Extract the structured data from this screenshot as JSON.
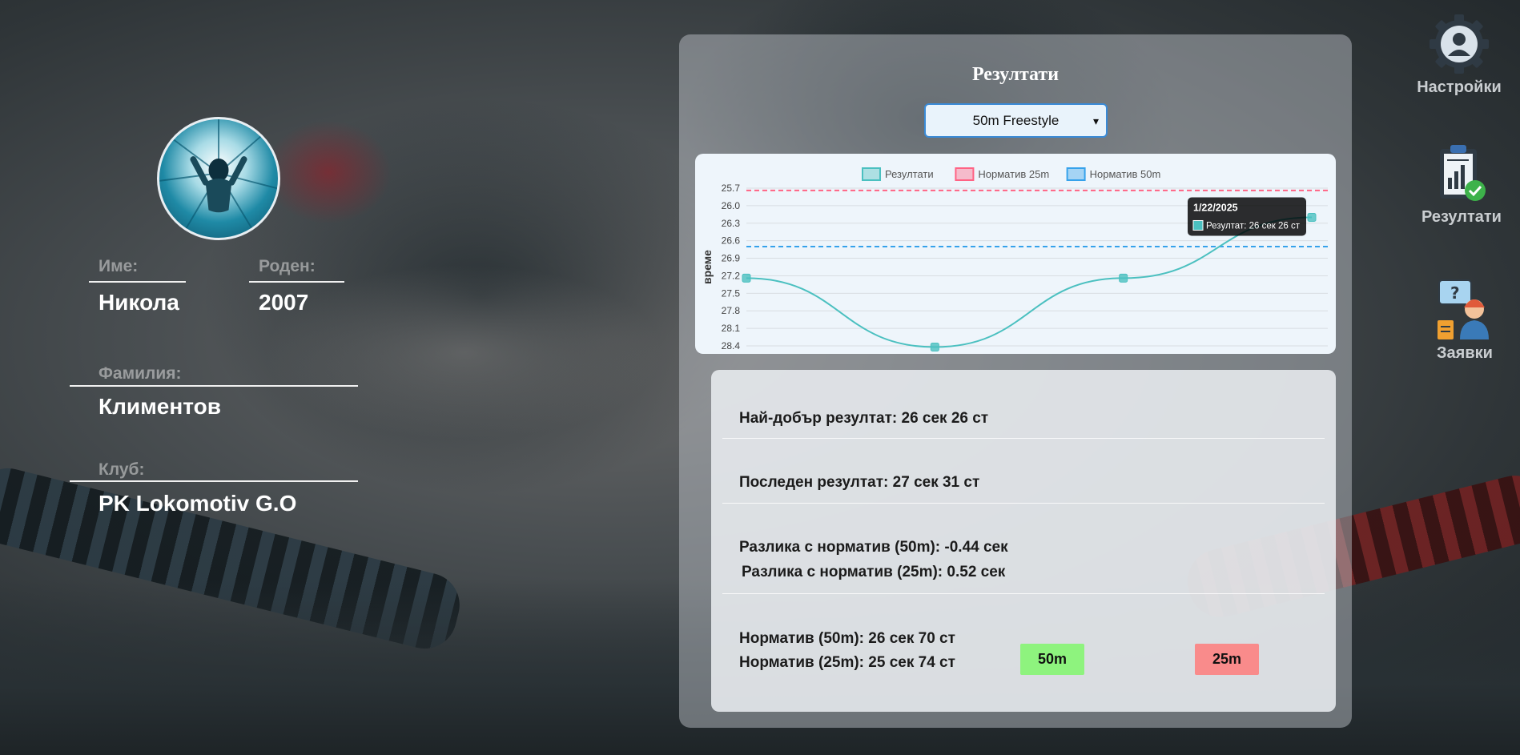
{
  "profile": {
    "labels": {
      "first_name": "Име:",
      "born": "Роден:",
      "last_name": "Фамилия:",
      "club": "Клуб:"
    },
    "first_name": "Никола",
    "born": "2007",
    "last_name": "Климентов",
    "club": "PK Lokomotiv G.O"
  },
  "results_panel": {
    "title": "Резултати",
    "event_select": {
      "selected": "50m Freestyle"
    }
  },
  "chart_data": {
    "type": "line",
    "legend": [
      "Резултати",
      "Норматив 25m",
      "Норматив 50m"
    ],
    "ylabel": "време",
    "y_ticks": [
      "25.7",
      "26.0",
      "26.3",
      "26.6",
      "26.9",
      "27.2",
      "27.5",
      "27.8",
      "28.1",
      "28.4"
    ],
    "ylim": [
      28.4,
      25.7
    ],
    "y_reversed": true,
    "series": [
      {
        "name": "Резултати",
        "color": "#4bc0c0",
        "values": [
          27.24,
          28.42,
          27.24,
          26.2
        ]
      }
    ],
    "reference_lines": [
      {
        "name": "Норматив 25m",
        "color": "#ff6384",
        "value": 25.74
      },
      {
        "name": "Норматив 50m",
        "color": "#36a2eb",
        "value": 26.7
      }
    ],
    "tooltip": {
      "title": "1/22/2025",
      "text": "Резултат: 26 сек 26 ст"
    }
  },
  "stats": {
    "best": "Най-добър резултат: 26 сек 26 ст",
    "last": "Последен резултат: 27 сек 31 ст",
    "diff_50": "Разлика с норматив (50m): -0.44 сек",
    "diff_25": "Разлика с норматив (25m): 0.52 сек",
    "norm_50": "Норматив (50m): 26 сек 70 ст",
    "norm_25": "Норматив (25m): 25 сек 74 ст",
    "btn_50": "50m",
    "btn_25": "25m",
    "btn_50_color": "#8ef37e",
    "btn_25_color": "#f98b8b"
  },
  "nav": {
    "settings": {
      "label": "Настройки",
      "icon": "gear-user-icon"
    },
    "results": {
      "label": "Резултати",
      "icon": "clipboard-chart-icon"
    },
    "requests": {
      "label": "Заявки",
      "icon": "support-agent-icon"
    }
  }
}
